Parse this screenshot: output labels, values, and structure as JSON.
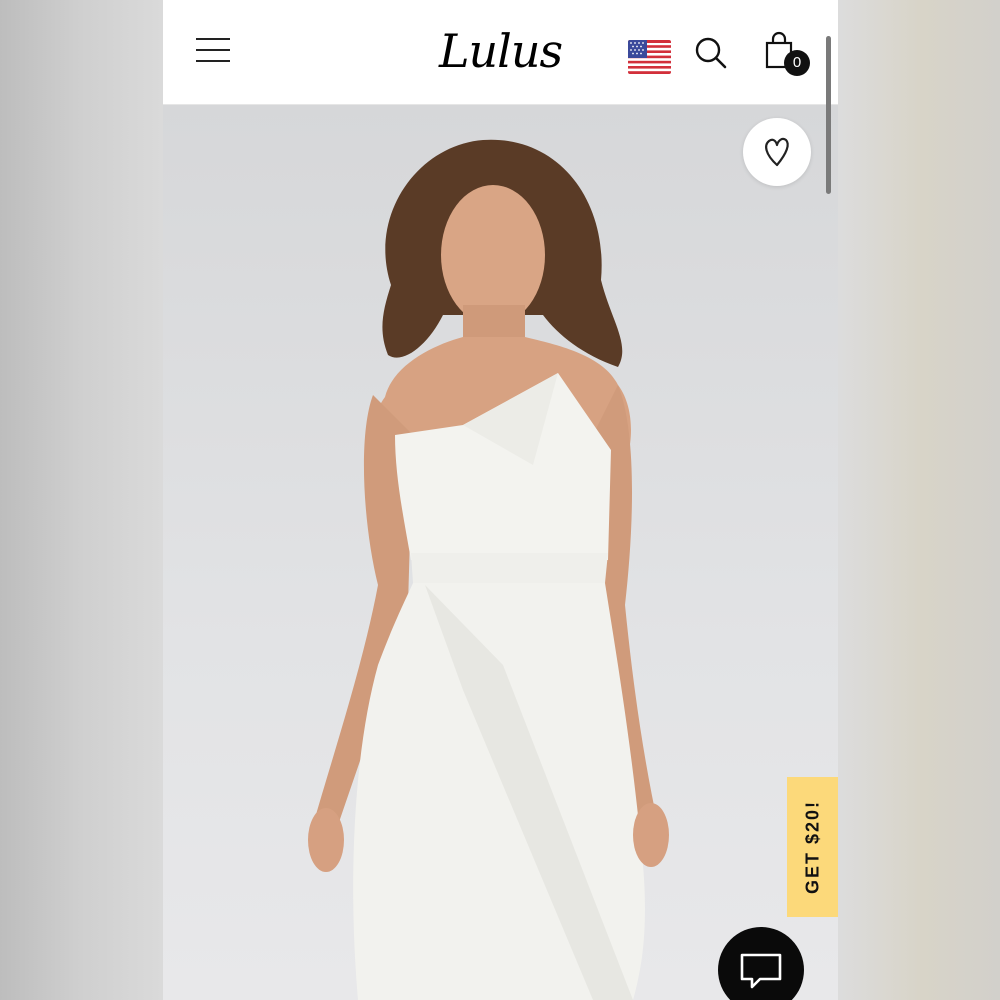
{
  "header": {
    "logo_text": "Lulus",
    "cart_count": "0",
    "icons": {
      "menu": "hamburger-menu-icon",
      "flag": "us-flag-icon",
      "search": "search-icon",
      "cart": "shopping-bag-icon"
    }
  },
  "product": {
    "wishlist_icon": "heart-icon"
  },
  "promo": {
    "label": "GET $20!",
    "color": "#fcd97a"
  },
  "chat": {
    "icon": "chat-bubble-icon",
    "color": "#0a0a0a"
  }
}
